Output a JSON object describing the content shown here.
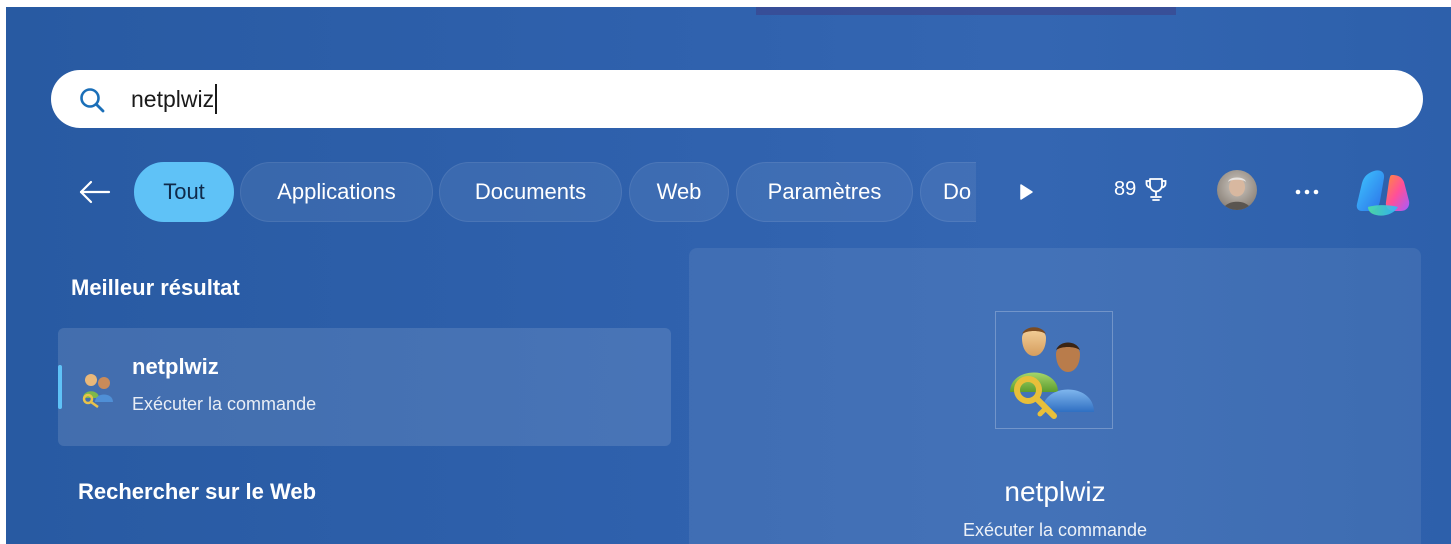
{
  "search": {
    "value": "netplwiz",
    "icon": "search-icon"
  },
  "filters": {
    "back_icon": "back-arrow-icon",
    "chips": [
      {
        "label": "Tout",
        "active": true
      },
      {
        "label": "Applications",
        "active": false
      },
      {
        "label": "Documents",
        "active": false
      },
      {
        "label": "Web",
        "active": false
      },
      {
        "label": "Paramètres",
        "active": false
      },
      {
        "label": "Do",
        "active": false
      }
    ],
    "scroll_icon": "play-arrow-icon"
  },
  "header": {
    "points": "89",
    "trophy_icon": "trophy-icon",
    "avatar_icon": "user-avatar",
    "more_icon": "more-dots-icon",
    "copilot_icon": "copilot-icon"
  },
  "best_result": {
    "section_title": "Meilleur résultat",
    "title": "netplwiz",
    "subtitle": "Exécuter la commande",
    "icon": "users-key-icon"
  },
  "web_search": {
    "section_title": "Rechercher sur le Web"
  },
  "preview": {
    "title": "netplwiz",
    "subtitle": "Exécuter la commande",
    "icon": "users-key-icon"
  },
  "colors": {
    "background": "#2f61ad",
    "accent": "#5fc2f7",
    "text": "#ffffff"
  }
}
